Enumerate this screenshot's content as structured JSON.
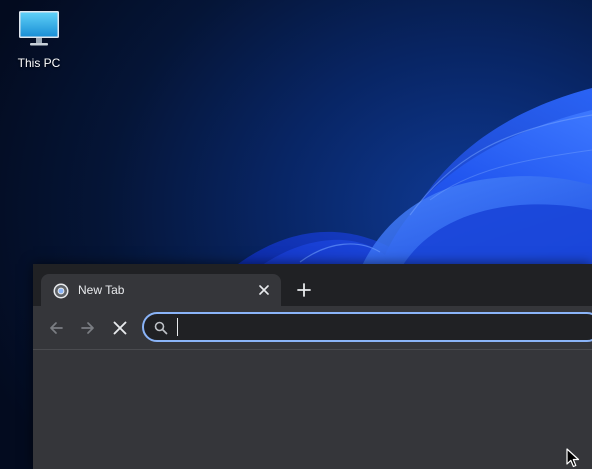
{
  "desktop": {
    "icons": [
      {
        "label": "This PC",
        "icon": "monitor-icon"
      }
    ]
  },
  "browser": {
    "tabs": [
      {
        "title": "New Tab",
        "favicon": "chromium-logo-icon",
        "active": true
      }
    ],
    "new_tab_icon": "plus-icon",
    "toolbar": {
      "back_icon": "arrow-left-icon",
      "forward_icon": "arrow-right-icon",
      "stop_icon": "close-icon"
    },
    "omnibox": {
      "value": "",
      "placeholder": "",
      "icon": "search-icon",
      "focus_color": "#8ab4f8"
    }
  },
  "colors": {
    "frame": "#202124",
    "toolbar": "#35363a",
    "text": "#e8eaed"
  }
}
